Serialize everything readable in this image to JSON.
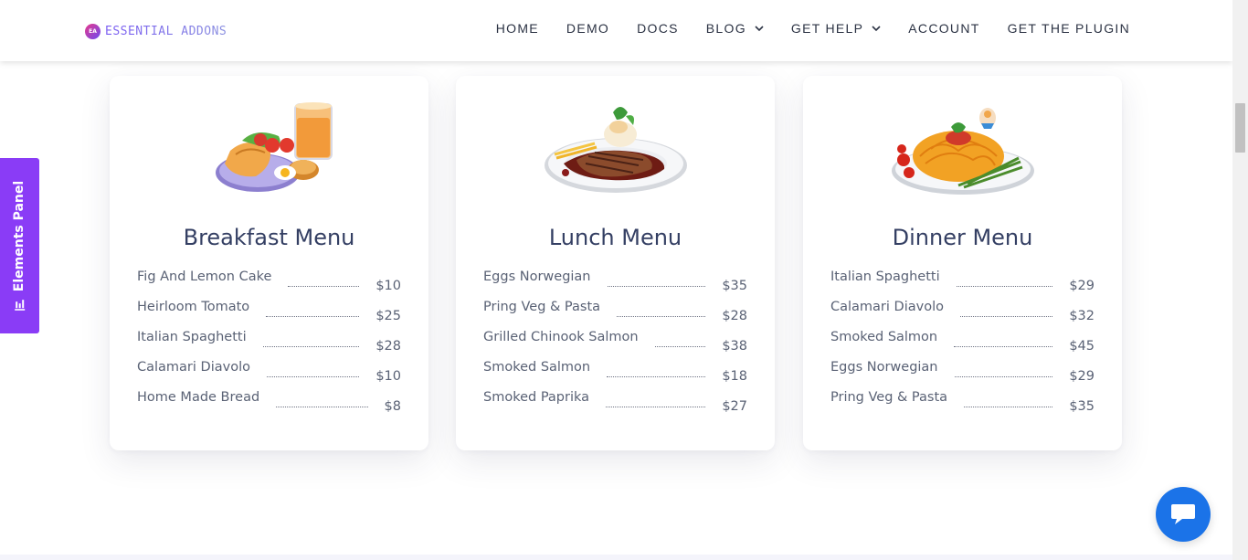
{
  "header": {
    "logo_text": "ESSENTIAL ADDONS",
    "logo_mark": "EA",
    "nav": [
      {
        "label": "HOME",
        "has_dropdown": false
      },
      {
        "label": "DEMO",
        "has_dropdown": false
      },
      {
        "label": "DOCS",
        "has_dropdown": false
      },
      {
        "label": "BLOG",
        "has_dropdown": true
      },
      {
        "label": "GET HELP",
        "has_dropdown": true
      },
      {
        "label": "ACCOUNT",
        "has_dropdown": false
      },
      {
        "label": "GET THE PLUGIN",
        "has_dropdown": false
      }
    ]
  },
  "elements_panel": {
    "label": "Elements Panel",
    "icon": "bar-chart-icon",
    "color": "#8a3cf6"
  },
  "cards": [
    {
      "title": "Breakfast Menu",
      "image": "breakfast-plate-image",
      "items": [
        {
          "name": "Fig And Lemon Cake",
          "price": "$10"
        },
        {
          "name": "Heirloom Tomato",
          "price": "$25"
        },
        {
          "name": "Italian Spaghetti",
          "price": "$28"
        },
        {
          "name": "Calamari Diavolo",
          "price": "$10"
        },
        {
          "name": "Home Made Bread",
          "price": "$8"
        }
      ]
    },
    {
      "title": "Lunch Menu",
      "image": "steak-plate-image",
      "items": [
        {
          "name": "Eggs Norwegian",
          "price": "$35"
        },
        {
          "name": "Pring Veg & Pasta",
          "price": "$28"
        },
        {
          "name": "Grilled Chinook Salmon",
          "price": "$38"
        },
        {
          "name": "Smoked Salmon",
          "price": "$18"
        },
        {
          "name": "Smoked Paprika",
          "price": "$27"
        }
      ]
    },
    {
      "title": "Dinner Menu",
      "image": "spaghetti-plate-image",
      "items": [
        {
          "name": "Italian Spaghetti",
          "price": "$29"
        },
        {
          "name": "Calamari Diavolo",
          "price": "$32"
        },
        {
          "name": "Smoked Salmon",
          "price": "$45"
        },
        {
          "name": "Eggs Norwegian",
          "price": "$29"
        },
        {
          "name": "Pring Veg & Pasta",
          "price": "$35"
        }
      ]
    }
  ],
  "chat": {
    "icon": "chat-bubble-icon",
    "color": "#1b73e8"
  }
}
